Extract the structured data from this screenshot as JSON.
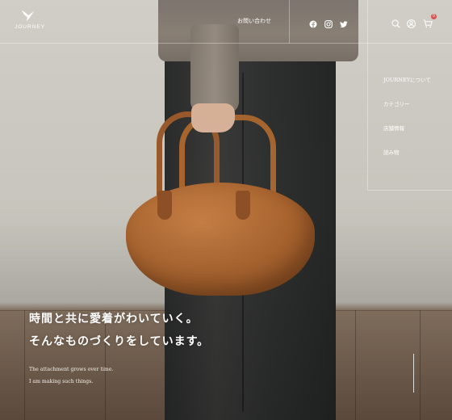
{
  "brand": {
    "name": "JOURNEY"
  },
  "header": {
    "contact_label": "お問い合わせ"
  },
  "social_icons": [
    "facebook-icon",
    "instagram-icon",
    "twitter-icon"
  ],
  "utility_icons": [
    "search-icon",
    "account-icon",
    "cart-icon"
  ],
  "cart": {
    "count": "0"
  },
  "side_nav": {
    "items": [
      {
        "label": "JOURNEYについて"
      },
      {
        "label": "カテゴリー"
      },
      {
        "label": "店舗情報"
      },
      {
        "label": "読み物"
      }
    ]
  },
  "hero": {
    "headline_line1": "時間と共に愛着がわいていく。",
    "headline_line2": "そんなものづくりをしています。",
    "sub_line1": "The attachment grows over time.",
    "sub_line2": "I am making such things."
  },
  "colors": {
    "accent_badge": "#d9534f",
    "leather": "#a9642f",
    "text": "#ffffff"
  }
}
